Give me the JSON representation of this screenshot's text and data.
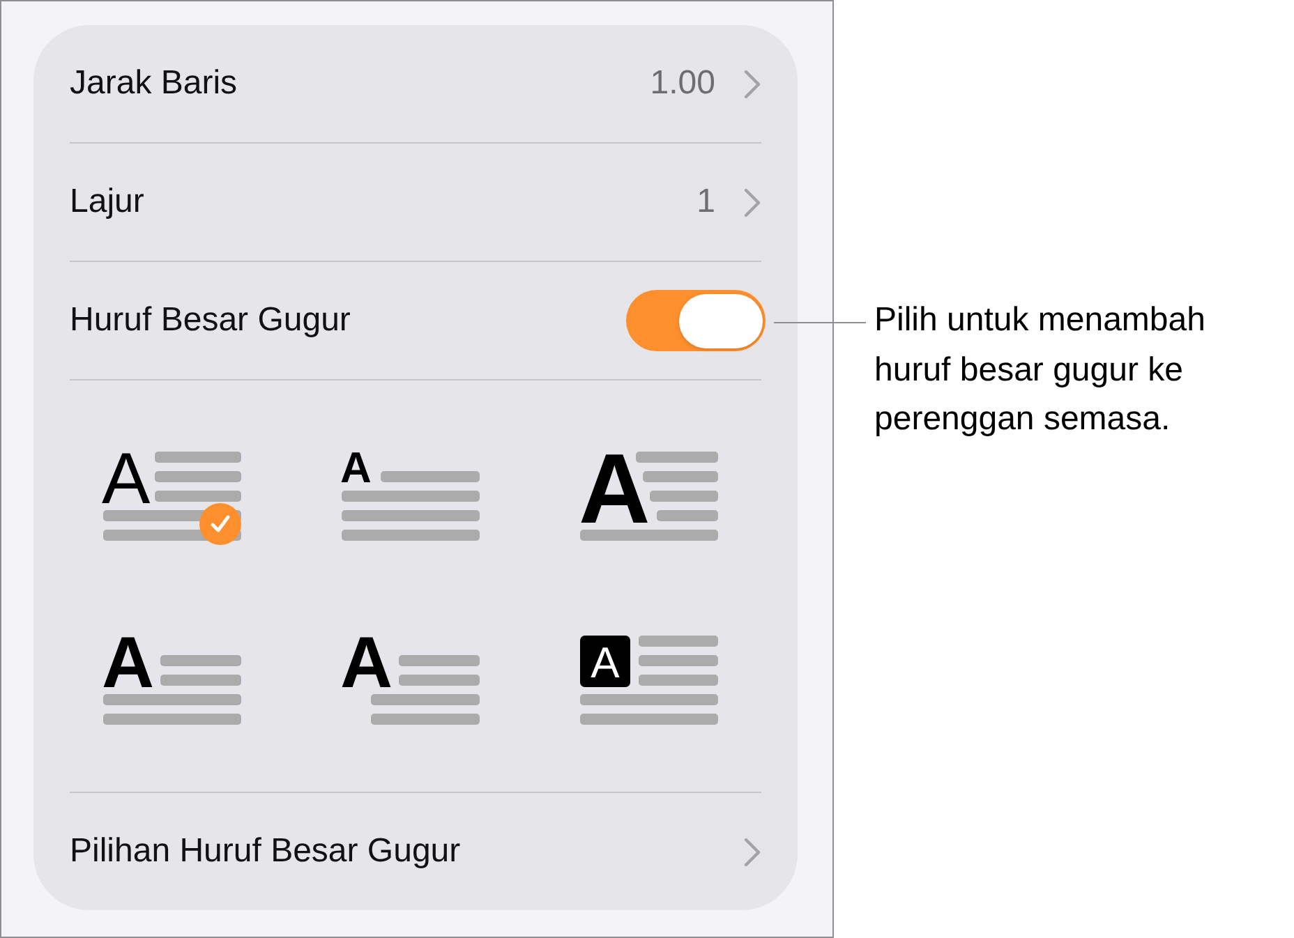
{
  "settings_card": {
    "rows": [
      {
        "kind": "value",
        "label": "Jarak Baris",
        "value": "1.00"
      },
      {
        "kind": "value",
        "label": "Lajur",
        "value": "1"
      },
      {
        "kind": "toggle",
        "label": "Huruf Besar Gugur",
        "on": true
      },
      {
        "kind": "styles",
        "options": [
          {
            "kind": "light",
            "letter": "A",
            "selected": true
          },
          {
            "kind": "small",
            "letter": "A",
            "selected": false
          },
          {
            "kind": "tall",
            "letter": "A",
            "selected": false
          },
          {
            "kind": "bold",
            "letter": "A",
            "selected": false
          },
          {
            "kind": "hanging",
            "letter": "A",
            "selected": false
          },
          {
            "kind": "boxed",
            "letter": "A",
            "selected": false
          }
        ]
      },
      {
        "kind": "link",
        "label": "Pilihan Huruf Besar Gugur"
      }
    ]
  },
  "callout": {
    "text": "Pilih untuk menambah huruf besar gugur ke perenggan semasa."
  }
}
